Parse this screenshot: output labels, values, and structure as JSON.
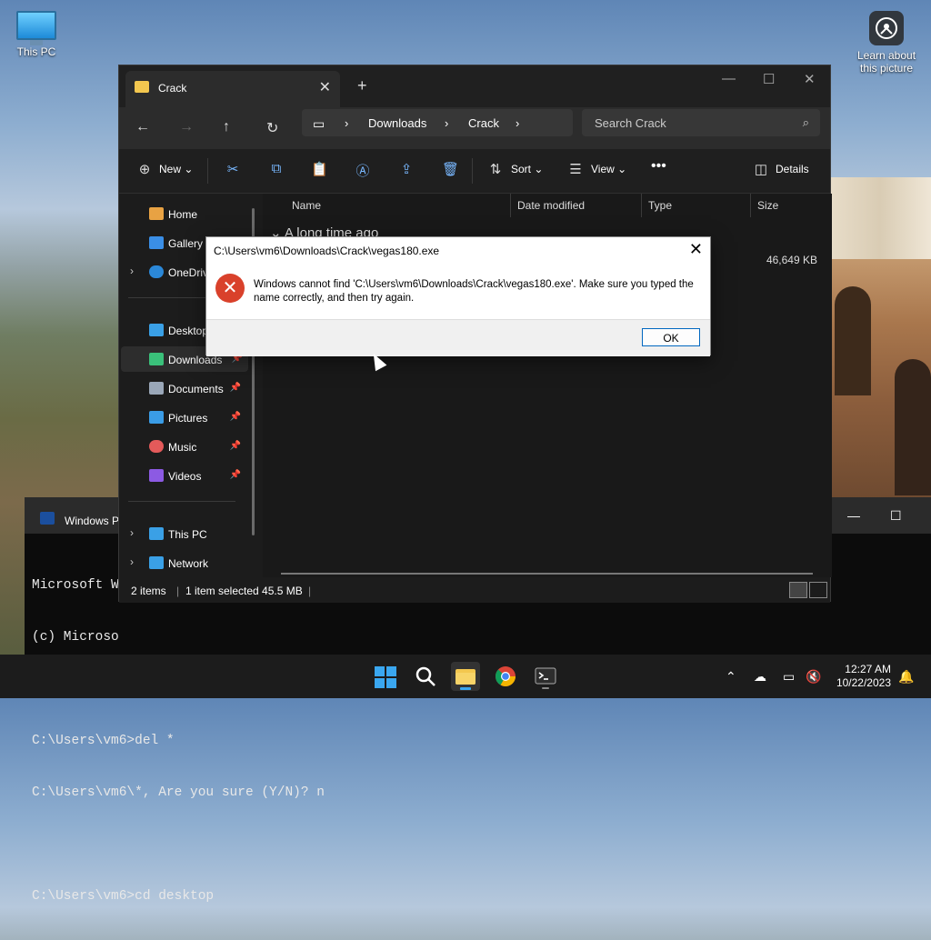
{
  "desktop": {
    "this_pc_label": "This PC",
    "learn_label_line1": "Learn about",
    "learn_label_line2": "this picture"
  },
  "terminal": {
    "tab_title": "Windows P",
    "lines": [
      "Microsoft W",
      "(c) Microso",
      "",
      "C:\\Users\\vm6>del *",
      "C:\\Users\\vm6\\*, Are you sure (Y/N)? n",
      "",
      "C:\\Users\\vm6>cd desktop"
    ]
  },
  "explorer": {
    "tab_title": "Crack",
    "breadcrumb": [
      "Downloads",
      "Crack"
    ],
    "search_placeholder": "Search Crack",
    "toolbar": {
      "new_label": "New",
      "sort_label": "Sort",
      "view_label": "View",
      "details_label": "Details"
    },
    "sidebar": [
      {
        "label": "Home",
        "icon": "home-icon",
        "color": "#e8a243"
      },
      {
        "label": "Gallery",
        "icon": "gallery-icon",
        "color": "#3a8ee6"
      },
      {
        "label": "OneDrive",
        "icon": "onedrive-icon",
        "color": "#2b88d8"
      },
      {
        "label": "Desktop",
        "icon": "desktop-icon",
        "color": "#3aa0e6"
      },
      {
        "label": "Downloads",
        "icon": "download-icon",
        "color": "#3ac07a"
      },
      {
        "label": "Documents",
        "icon": "document-icon",
        "color": "#9aa7b8"
      },
      {
        "label": "Pictures",
        "icon": "pictures-icon",
        "color": "#3a9ce6"
      },
      {
        "label": "Music",
        "icon": "music-icon",
        "color": "#e35a5a"
      },
      {
        "label": "Videos",
        "icon": "videos-icon",
        "color": "#8c5ae3"
      },
      {
        "label": "This PC",
        "icon": "this-pc-icon",
        "color": "#3aa0e6"
      },
      {
        "label": "Network",
        "icon": "network-icon",
        "color": "#3aa0e6"
      }
    ],
    "columns": [
      "Name",
      "Date modified",
      "Type",
      "Size"
    ],
    "group_label": "A long time ago",
    "row_size": "46,649 KB",
    "status": {
      "items": "2 items",
      "selected": "1 item selected  45.5 MB"
    }
  },
  "dialog": {
    "title": "C:\\Users\\vm6\\Downloads\\Crack\\vegas180.exe",
    "message": "Windows cannot find 'C:\\Users\\vm6\\Downloads\\Crack\\vegas180.exe'. Make sure you typed the name correctly, and then try again.",
    "ok_label": "OK"
  },
  "taskbar": {
    "time": "12:27 AM",
    "date": "10/22/2023"
  },
  "colors": {
    "accent": "#0067c0",
    "error": "#d9412b",
    "folder": "#f3c74f"
  }
}
